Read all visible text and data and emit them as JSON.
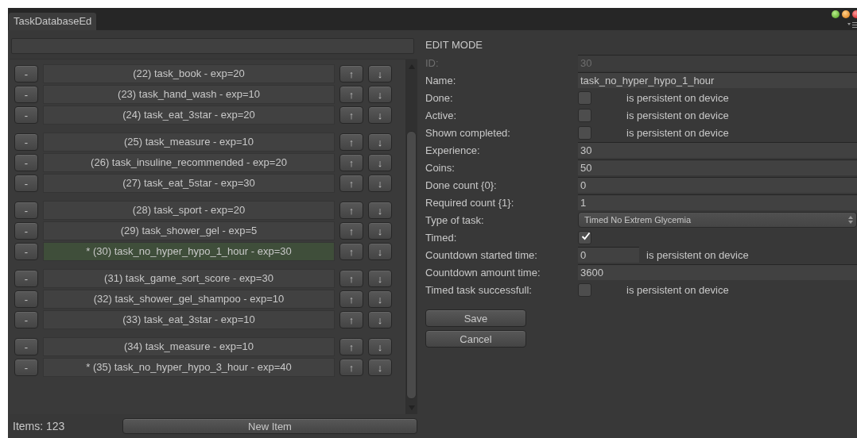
{
  "window": {
    "tab": "TaskDatabaseEd"
  },
  "groups": [
    {
      "items": [
        {
          "label": "(22) task_book - exp=20",
          "selected": false
        },
        {
          "label": "(23) task_hand_wash - exp=10",
          "selected": false
        },
        {
          "label": "(24) task_eat_3star - exp=20",
          "selected": false
        }
      ]
    },
    {
      "items": [
        {
          "label": "(25) task_measure - exp=10",
          "selected": false
        },
        {
          "label": "(26) task_insuline_recommended - exp=20",
          "selected": false
        },
        {
          "label": "(27) task_eat_5star - exp=30",
          "selected": false
        }
      ]
    },
    {
      "items": [
        {
          "label": "(28) task_sport - exp=20",
          "selected": false
        },
        {
          "label": "(29) task_shower_gel - exp=5",
          "selected": false
        },
        {
          "label": "* (30) task_no_hyper_hypo_1_hour - exp=30",
          "selected": true
        }
      ]
    },
    {
      "items": [
        {
          "label": "(31) task_game_sort_score - exp=30",
          "selected": false
        },
        {
          "label": "(32) task_shower_gel_shampoo - exp=10",
          "selected": false
        },
        {
          "label": "(33) task_eat_3star - exp=10",
          "selected": false
        }
      ]
    },
    {
      "items": [
        {
          "label": "(34) task_measure - exp=10",
          "selected": false
        },
        {
          "label": "* (35) task_no_hyper_hypo_3_hour - exp=40",
          "selected": false
        }
      ]
    }
  ],
  "item_buttons": {
    "remove": "-",
    "up": "↑",
    "down": "↓"
  },
  "footer": {
    "count": "Items: 123",
    "new_button": "New Item"
  },
  "editor": {
    "heading": "EDIT MODE",
    "fields": [
      {
        "kind": "text",
        "label": "ID:",
        "value": "30",
        "disabled": true
      },
      {
        "kind": "text",
        "label": "Name:",
        "value": "task_no_hyper_hypo_1_hour",
        "disabled": false
      },
      {
        "kind": "checkbox",
        "label": "Done:",
        "checked": false,
        "note": "is persistent on device"
      },
      {
        "kind": "checkbox",
        "label": "Active:",
        "checked": false,
        "note": "is persistent on device"
      },
      {
        "kind": "checkbox",
        "label": "Shown completed:",
        "checked": false,
        "note": "is persistent on device"
      },
      {
        "kind": "text",
        "label": "Experience:",
        "value": "30",
        "disabled": false
      },
      {
        "kind": "text",
        "label": "Coins:",
        "value": "50",
        "disabled": false
      },
      {
        "kind": "text",
        "label": "Done count {0}:",
        "value": "0",
        "disabled": false
      },
      {
        "kind": "text",
        "label": "Required count {1}:",
        "value": "1",
        "disabled": false
      },
      {
        "kind": "dropdown",
        "label": "Type of task:",
        "value": "Timed No Extrem Glycemia"
      },
      {
        "kind": "checkbox",
        "label": "Timed:",
        "checked": true
      },
      {
        "kind": "short_text",
        "label": "Countdown started time:",
        "value": "0",
        "note": "is persistent on device"
      },
      {
        "kind": "text",
        "label": "Countdown amount time:",
        "value": "3600",
        "disabled": false
      },
      {
        "kind": "checkbox",
        "label": "Timed task successfull:",
        "checked": false,
        "note": "is persistent on device"
      }
    ],
    "buttons": [
      "Save",
      "Cancel"
    ]
  }
}
